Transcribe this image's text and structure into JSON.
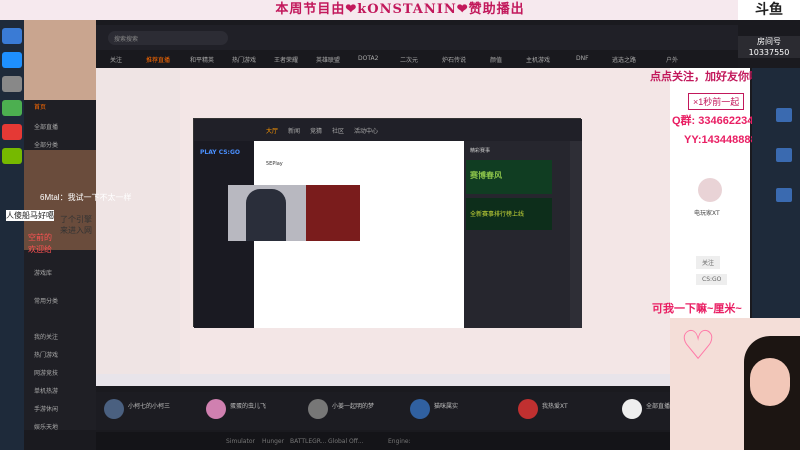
{
  "banner": {
    "text": "本周节目由❤kONSTANIN❤赞助播出"
  },
  "corner_logo": "斗鱼",
  "room": {
    "label": "房间号",
    "number": "10337550"
  },
  "app": {
    "brand": "斗鱼",
    "search_placeholder": "搜索搜索"
  },
  "top_tabs": [
    "关注",
    "推荐直播",
    "和平精英",
    "热门游戏",
    "王者荣耀",
    "英雄联盟",
    "DOTA2",
    "二次元",
    "炉石传说",
    "颜值",
    "主机游戏",
    "DNF",
    "逃选之路",
    "户外"
  ],
  "sidebar": [
    "历史",
    "首页",
    "全部直播",
    "全部分类",
    "游戏库",
    "常用分类",
    "编辑",
    "我的关注",
    "热门游戏",
    "网游竞技",
    "单机热游",
    "手游休闲",
    "娱乐天地"
  ],
  "overlay": {
    "follow_note": "点点关注，加好友你哦~",
    "gift_note": "×1秒前一起",
    "qq": "Q群: 334662234",
    "yy": "YY:1434488886",
    "bottom_note": "可我一下嘛~厘米~"
  },
  "chat": [
    {
      "user": "6Mtal",
      "text": "我试一下不太一样"
    },
    {
      "user": "",
      "text": "人傻船马好噶"
    },
    {
      "user": "",
      "text": "了个引擎"
    },
    {
      "user": "",
      "text": "来进入网"
    },
    {
      "user": "",
      "text": "空前的"
    },
    {
      "user": "",
      "text": "欢迎给"
    }
  ],
  "monitor": {
    "play_label": "PLAY CS:GO",
    "tabs": [
      "大厅",
      "新闻",
      "竞猜",
      "社区",
      "活动中心"
    ],
    "promo1": "赛博春风",
    "promo2": "全新赛事排行榜上线",
    "section": "精彩赛事",
    "post_author": "5EPlay"
  },
  "recommend": [
    {
      "title": "小柯七的小柯三",
      "sub": "【暗杀】连接"
    },
    {
      "title": "蛋蛋的虫儿飞",
      "sub": "【暗杀】5v5"
    },
    {
      "title": "小姜一起明的梦",
      "sub": "【全民】"
    },
    {
      "title": "猫咪属实",
      "sub": "最新游戏"
    },
    {
      "title": "我热爱XT",
      "sub": "游戏推荐"
    },
    {
      "title": "全部直播",
      "sub": ""
    }
  ],
  "bottom_bar": [
    "Simulator",
    "Hunger",
    "BATTLEGR...",
    "Global Off...",
    "Engine:"
  ],
  "right_panel": {
    "name": "电玩家XT",
    "follow": "关注",
    "level": "CS:GO"
  },
  "colors": {
    "accent": "#ff6a00",
    "pink": "#e91e63",
    "banner_bg": "#f6e9ee"
  }
}
